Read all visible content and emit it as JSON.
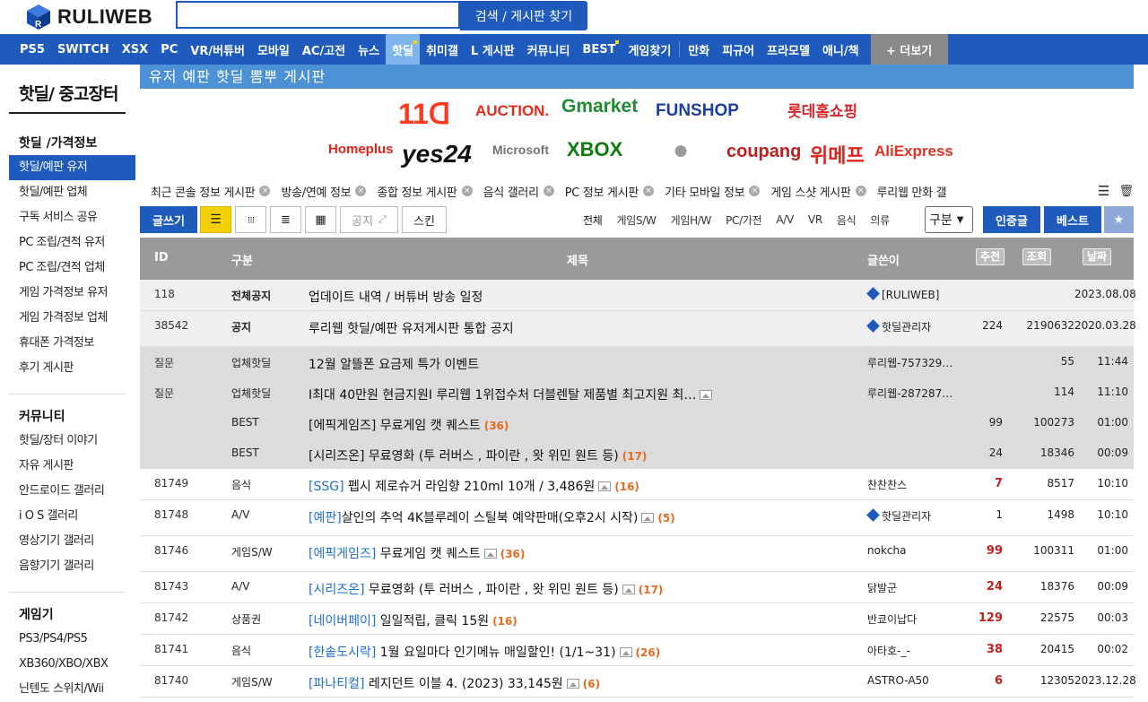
{
  "header": {
    "logo": "RULIWEB",
    "search_placeholder": "",
    "search_button": "검색 / 게시판 찾기"
  },
  "nav": {
    "items": [
      {
        "label": "PS5"
      },
      {
        "label": "SWITCH"
      },
      {
        "label": "XSX"
      },
      {
        "label": "PC"
      },
      {
        "label": "VR/버튜버"
      },
      {
        "label": "모바일"
      },
      {
        "label": "AC/고전"
      },
      {
        "label": "뉴스"
      },
      {
        "label": "핫딜",
        "active": true,
        "dot": true
      },
      {
        "label": "취미갤"
      },
      {
        "label": "L 게시판"
      },
      {
        "label": "커뮤니티"
      },
      {
        "label": "BEST",
        "dot": true
      },
      {
        "label": "게임찾기"
      },
      {
        "label": "만화"
      },
      {
        "label": "피규어"
      },
      {
        "label": "프라모델"
      },
      {
        "label": "애니/책"
      }
    ],
    "more": "+ 더보기"
  },
  "sidebar": {
    "title": "핫딜/ 중고장터",
    "groups": [
      {
        "name": "핫딜 /가격정보",
        "items": [
          "핫딜/예판 유저",
          "핫딜/예판 업체",
          "구독 서비스 공유",
          "PC 조립/견적 유저",
          "PC 조립/견적 업체",
          "게임 가격정보 유저",
          "게임 가격정보 업체",
          "휴대폰 가격정보",
          "후기 게시판"
        ]
      },
      {
        "name": "커뮤니티",
        "items": [
          "핫딜/장터 이야기",
          "자유 게시판",
          "안드로이드 갤러리",
          "i O S 갤러리",
          "영상기기 갤러리",
          "음향기기 갤러리"
        ]
      },
      {
        "name": "게임기",
        "items": [
          "PS3/PS4/PS5",
          "XB360/XBO/XBX",
          "닌텐도 스위치/Wii"
        ]
      }
    ]
  },
  "board": {
    "title": "유저 예판 핫딜 뽐뿌 게시판"
  },
  "logos": {
    "row1": [
      {
        "text": "11ᗡ",
        "color": "#ff3a1f"
      },
      {
        "text": "AUCTION.",
        "color": "#e62b1e"
      },
      {
        "text": "Gmarket",
        "color": "#1f8b34"
      },
      {
        "text": "FUNSHOP",
        "color": "#1d3f9e"
      },
      {
        "text": "롯데홈쇼핑",
        "color": "#d9242a"
      }
    ],
    "row2": [
      {
        "text": "Homeplus",
        "color": "#e2231a"
      },
      {
        "text": "yes24",
        "color": "#111111"
      },
      {
        "text": "Microsoft",
        "color": "#737373"
      },
      {
        "text": "XBOX",
        "color": "#107c10"
      },
      {
        "text": "coupang",
        "color": "#c2201e"
      },
      {
        "text": "위메프",
        "color": "#e2231a"
      },
      {
        "text": "AliExpress",
        "color": "#e43225"
      }
    ]
  },
  "tabs": [
    "최근 콘솔 정보 게시판",
    "방송/연예 정보",
    "종합 정보 게시판",
    "음식 갤러리",
    "PC 정보 게시판",
    "기타 모바일 정보",
    "게임 스샷 게시판",
    "루리웹 만화 갤"
  ],
  "toolbar": {
    "write": "글쓰기",
    "notice": "공지",
    "skin": "스킨",
    "select_value": "구분",
    "certified": "인증글",
    "best": "베스트",
    "cats": [
      "전체",
      "게임S/W",
      "게임H/W",
      "PC/가전",
      "A/V",
      "VR",
      "음식",
      "의류"
    ]
  },
  "table": {
    "headers": {
      "id": "ID",
      "cat": "구분",
      "title": "제목",
      "user": "글쓴이",
      "rec": "추천",
      "view": "조회",
      "date": "날짜"
    },
    "rows": [
      {
        "id": "118",
        "cat": "전체공지",
        "title": "업데이트 내역 / 버튜버 방송 일정",
        "user": "[RULIWEB]",
        "rec": "",
        "view": "",
        "date": "2023.08.08",
        "type": "notice",
        "bold": true,
        "uicon": true
      },
      {
        "id": "38542",
        "cat": "공지",
        "title": "루리웹 핫딜/예판 유저게시판 통합 공지",
        "user": "핫딜관리자",
        "rec": "224",
        "view": "2190632",
        "date": "2020.03.28",
        "type": "notice",
        "bold": true,
        "uicon": true
      },
      {
        "id": "질문",
        "cat": "업체핫딜",
        "title": "12월 알뜰폰 요금제 특가 이벤트",
        "user": "루리웹-757329…",
        "rec": "",
        "view": "55",
        "date": "11:44",
        "type": "grp"
      },
      {
        "id": "질문",
        "cat": "업체핫딜",
        "title": "I최대 40만원 현금지원I 루리웹 1위접수처 더블렌탈 제품별 최고지원 최…",
        "user": "루리웹-287287…",
        "rec": "",
        "view": "114",
        "date": "11:10",
        "type": "grp",
        "img": true
      },
      {
        "id": "",
        "cat": "BEST",
        "title": "[에픽게임즈] 무료게임 캣 퀘스트",
        "count": "(36)",
        "user": "",
        "rec": "99",
        "view": "100273",
        "date": "01:00",
        "type": "grp"
      },
      {
        "id": "",
        "cat": "BEST",
        "title": "[시리즈온] 무료영화 (투 러버스 , 파이란 , 왓 위민 원트 등)",
        "count": "(17)",
        "user": "",
        "rec": "24",
        "view": "18346",
        "date": "00:09",
        "type": "grp"
      },
      {
        "id": "81749",
        "cat": "음식",
        "prefix": "[SSG]",
        "title": " 펩시 제로슈거 라임향 210ml 10개 / 3,486원",
        "count": "(16)",
        "user": "찬찬찬스",
        "rec": "7",
        "view": "8517",
        "date": "10:10",
        "img": true,
        "redrec": true
      },
      {
        "id": "81748",
        "cat": "A/V",
        "prefix": "[예판]",
        "title": "살인의 추억 4K블루레이 스틸북 예약판매(오후2시 시작)",
        "count": "(5)",
        "user": "핫딜관리자",
        "rec": "1",
        "view": "1498",
        "date": "10:10",
        "img": true,
        "uicon": true
      },
      {
        "id": "81746",
        "cat": "게임S/W",
        "prefix": "[에픽게임즈]",
        "title": " 무료게임 캣 퀘스트",
        "count": "(36)",
        "user": "nokcha",
        "rec": "99",
        "view": "100311",
        "date": "01:00",
        "img": true,
        "redrec": true
      },
      {
        "id": "81743",
        "cat": "A/V",
        "prefix": "[시리즈온]",
        "title": " 무료영화 (투 러버스 , 파이란 , 왓 위민 원트 등)",
        "count": "(17)",
        "user": "닭발군",
        "rec": "24",
        "view": "18376",
        "date": "00:09",
        "img": true,
        "redrec": true
      },
      {
        "id": "81742",
        "cat": "상품권",
        "prefix": "[네이버페이]",
        "title": " 일일적립, 클릭 15원",
        "count": "(16)",
        "user": "반쿄이납다",
        "rec": "129",
        "view": "22575",
        "date": "00:03",
        "redrec": true
      },
      {
        "id": "81741",
        "cat": "음식",
        "prefix": "[한솥도시락]",
        "title": " 1월 요일마다 인기메뉴 매일할인! (1/1~31)",
        "count": "(26)",
        "user": "아타호-_-",
        "rec": "38",
        "view": "20415",
        "date": "00:02",
        "img": true,
        "redrec": true
      },
      {
        "id": "81740",
        "cat": "게임S/W",
        "prefix": "[파나티컬]",
        "title": " 레지던트 이블 4. (2023) 33,145원",
        "count": "(6)",
        "user": "ASTRO-A50",
        "rec": "6",
        "view": "12305",
        "date": "2023.12.28",
        "img": true,
        "redrec": true
      }
    ]
  }
}
